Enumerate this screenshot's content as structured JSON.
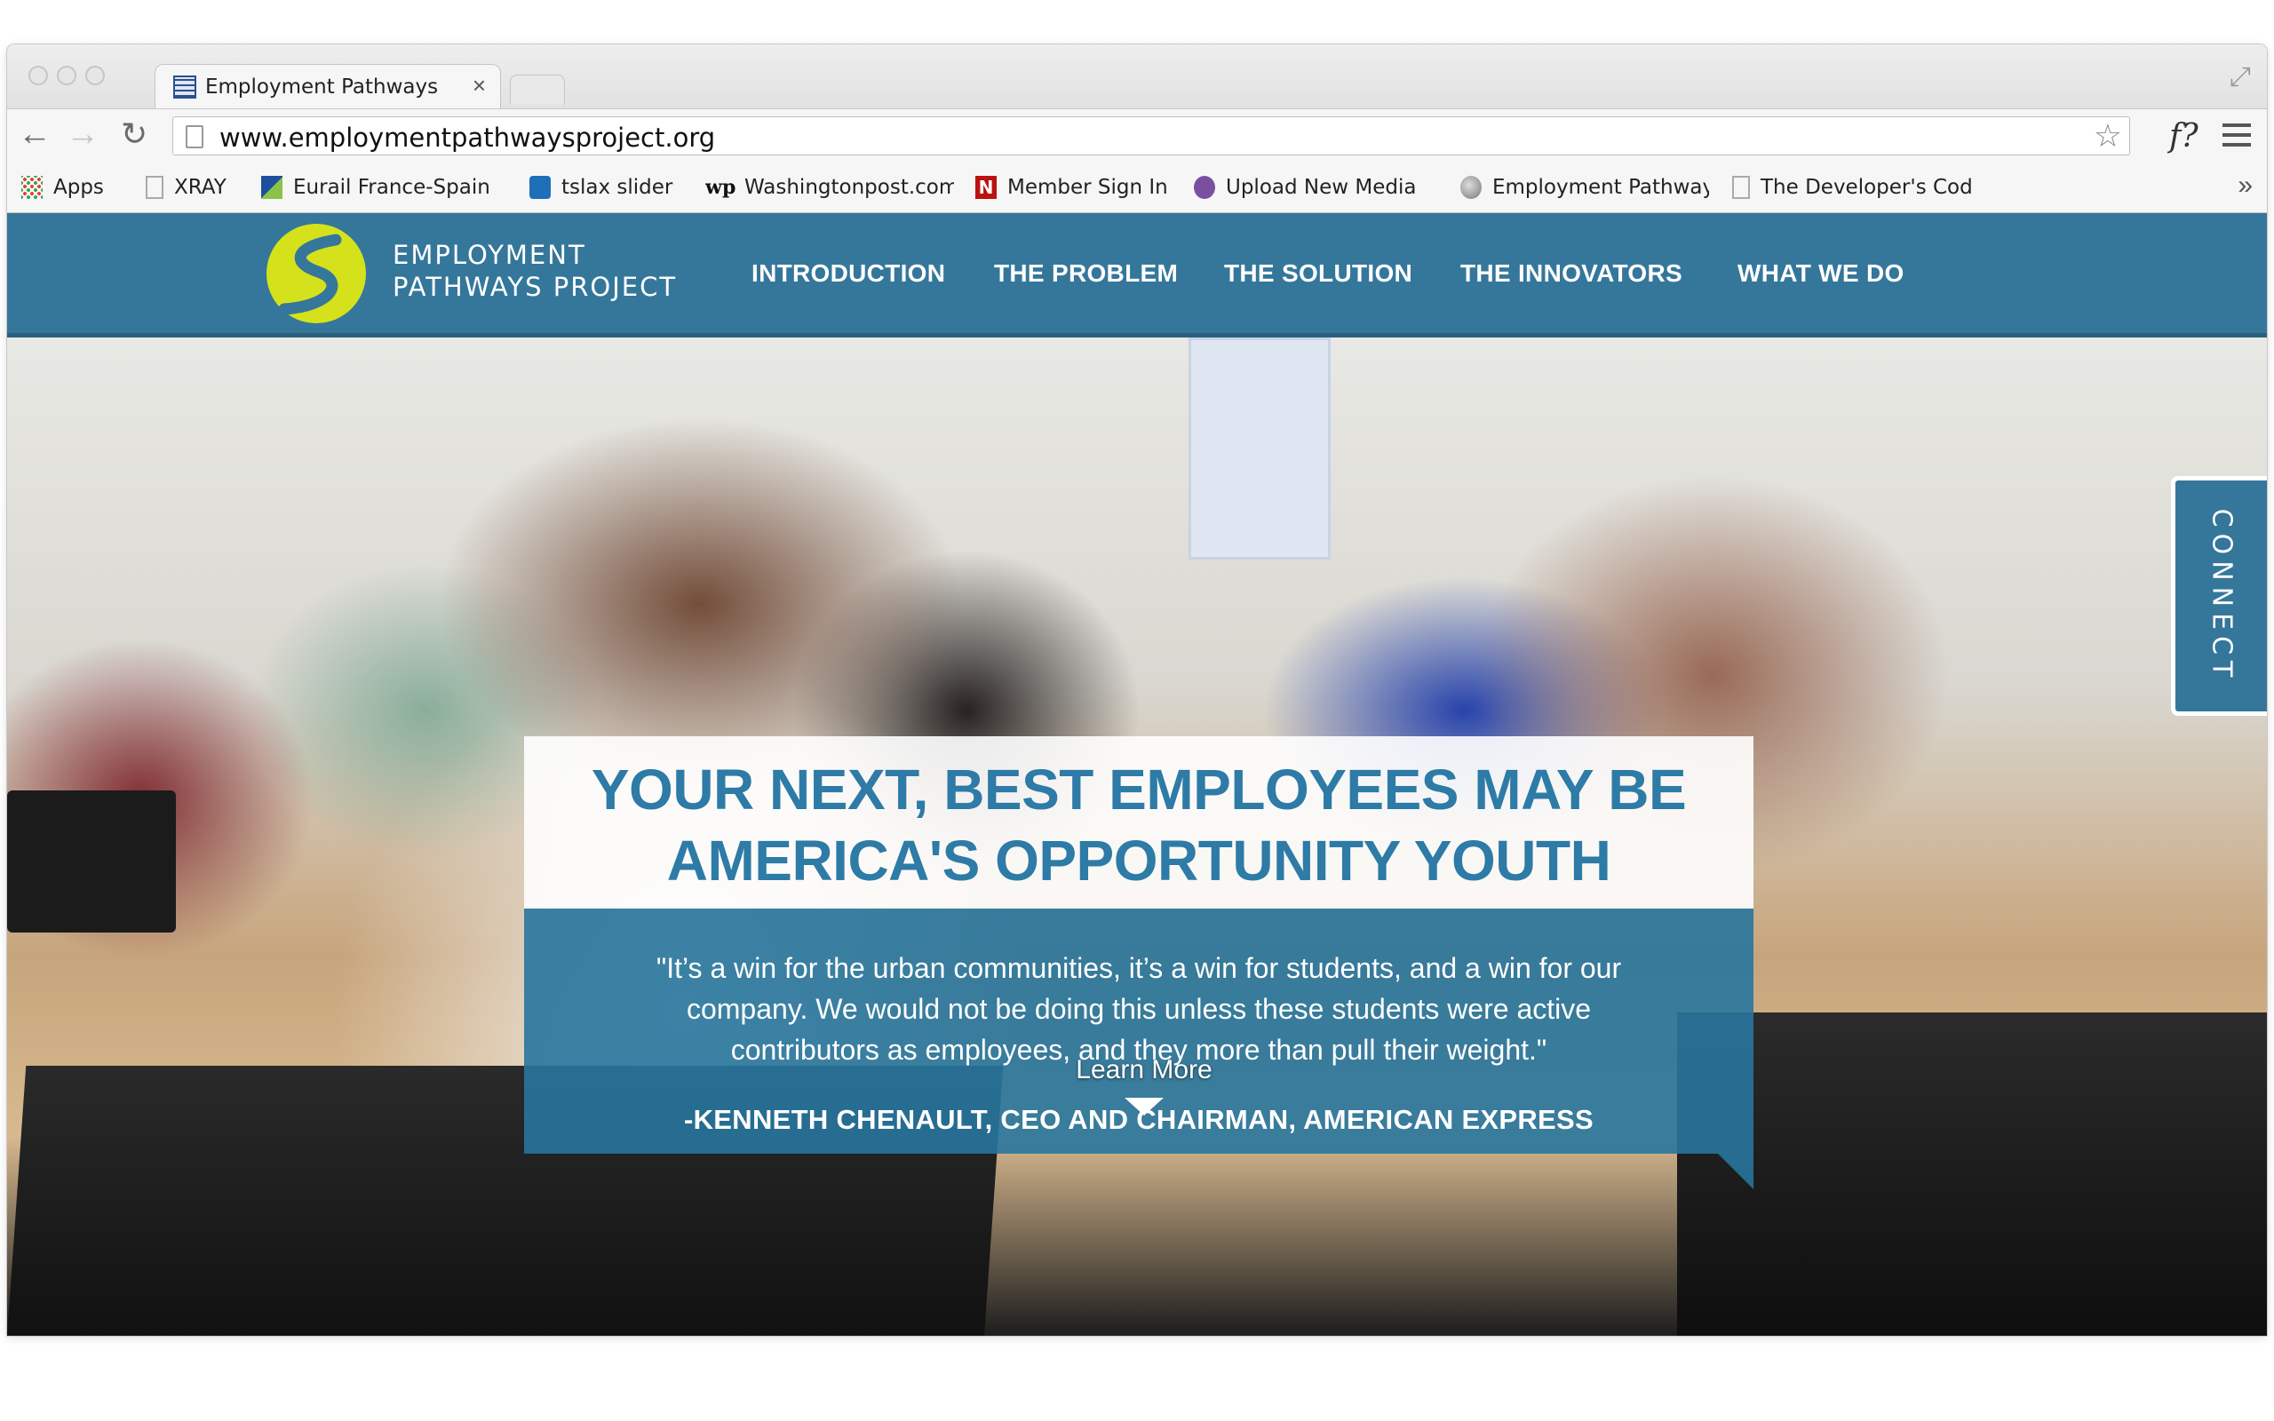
{
  "browser": {
    "tab_title": "Employment Pathways",
    "tab_close": "×",
    "url": "www.employmentpathwaysproject.org",
    "menu_button_label": "f?",
    "bookmarks": [
      {
        "label": "Apps",
        "icon": "apps-grid-icon"
      },
      {
        "label": "XRAY",
        "icon": "page-icon"
      },
      {
        "label": "Eurail France-Spain",
        "icon": "eurail-icon"
      },
      {
        "label": "tslax slider",
        "icon": "drop-icon"
      },
      {
        "label": "Washingtonpost.com",
        "icon": "wp-icon"
      },
      {
        "label": "Member Sign In",
        "icon": "netflix-icon"
      },
      {
        "label": "Upload New Media",
        "icon": "wordpress-icon"
      },
      {
        "label": "Employment Pathway",
        "icon": "globe-icon"
      },
      {
        "label": "The Developer's Cod",
        "icon": "page-icon"
      }
    ],
    "bookmarks_overflow": "»"
  },
  "site": {
    "logo": {
      "line1": "EMPLOYMENT",
      "line2": "PATHWAYS PROJECT"
    },
    "nav": [
      "INTRODUCTION",
      "THE PROBLEM",
      "THE SOLUTION",
      "THE INNOVATORS",
      "WHAT WE DO"
    ],
    "connect_label": "CONNECT",
    "headline": "YOUR NEXT, BEST EMPLOYEES MAY BE AMERICA'S OPPORTUNITY YOUTH",
    "quote": "\"It’s a win for the urban communities, it’s a win for students, and a win for our company. We would not be doing this unless these students were active contributors as employees, and they more than pull their weight.\"",
    "attribution": "-KENNETH CHENAULT, CEO AND CHAIRMAN, AMERICAN EXPRESS",
    "learn_more": "Learn More"
  },
  "colors": {
    "brand_blue": "#35779b",
    "headline_blue": "#2d7ba6",
    "logo_lime": "#d5e21b"
  }
}
